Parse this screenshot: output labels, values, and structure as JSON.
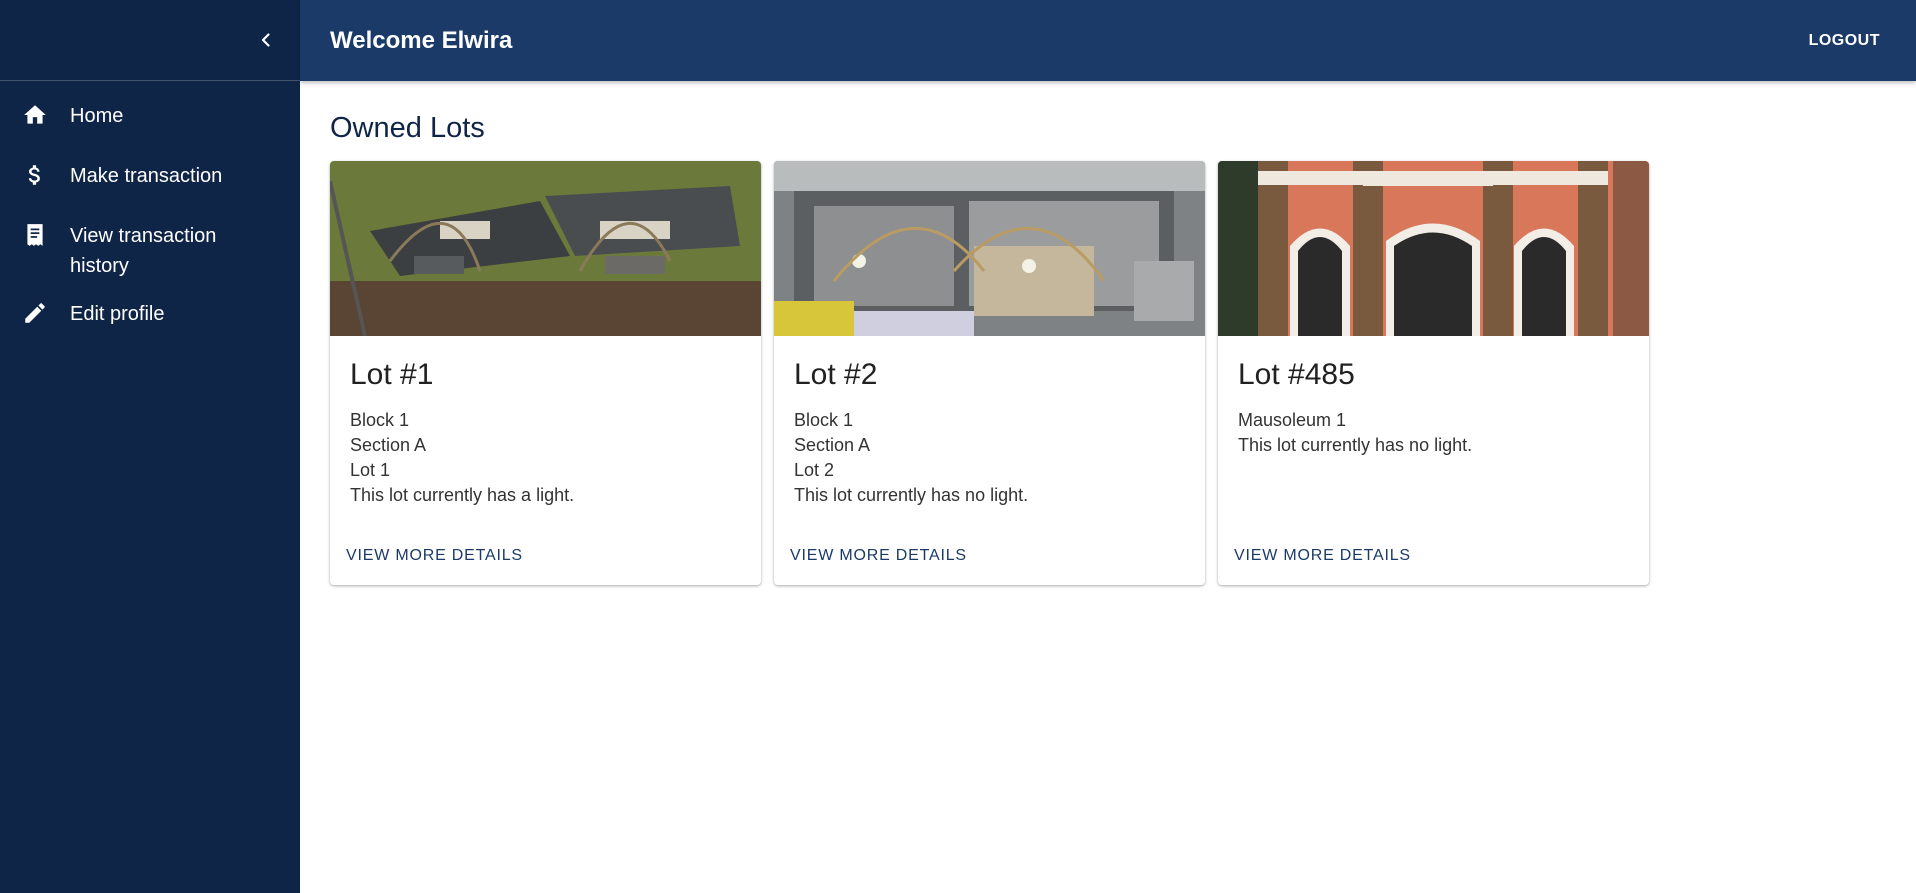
{
  "app": {
    "welcome": "Welcome Elwira",
    "logout_label": "LOGOUT",
    "colors": {
      "sidebar": "#0f2547",
      "appbar": "#1b3a68",
      "accent": "#1b3a68"
    }
  },
  "sidebar": {
    "collapse_icon": "chevron-left-icon",
    "items": [
      {
        "label": "Home",
        "icon": "home-icon"
      },
      {
        "label": "Make transaction",
        "icon": "dollar-icon"
      },
      {
        "label": "View transaction history",
        "icon": "receipt-icon"
      },
      {
        "label": "Edit profile",
        "icon": "pencil-icon"
      }
    ]
  },
  "main": {
    "title": "Owned Lots",
    "lots": [
      {
        "title": "Lot #1",
        "lines": [
          "Block 1",
          "Section A",
          "Lot 1",
          "This lot currently has a light."
        ],
        "action": "VIEW MORE DETAILS"
      },
      {
        "title": "Lot #2",
        "lines": [
          "Block 1",
          "Section A",
          "Lot 2",
          "This lot currently has no light."
        ],
        "action": "VIEW MORE DETAILS"
      },
      {
        "title": "Lot #485",
        "lines": [
          "Mausoleum 1",
          "This lot currently has no light."
        ],
        "action": "VIEW MORE DETAILS"
      }
    ]
  }
}
